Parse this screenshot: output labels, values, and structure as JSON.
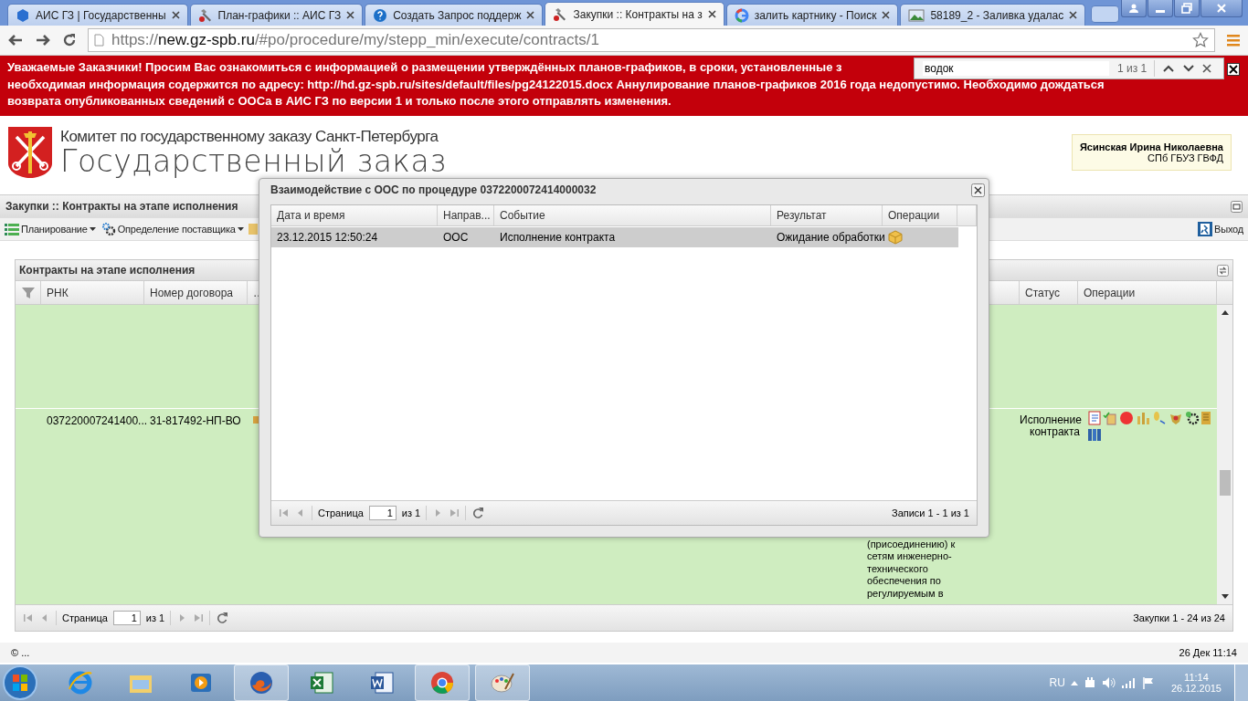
{
  "browser": {
    "tabs": [
      {
        "title": "АИС ГЗ | Государственны",
        "selected": false
      },
      {
        "title": "План-графики :: АИС ГЗ",
        "selected": false
      },
      {
        "title": "Создать Запрос поддерж",
        "selected": false
      },
      {
        "title": "Закупки :: Контракты на з",
        "selected": true
      },
      {
        "title": "залить картнику - Поиск",
        "selected": false
      },
      {
        "title": "58189_2 - Заливка удалас",
        "selected": false
      }
    ],
    "url_host": "new.gz-spb.ru",
    "url_scheme": "https://",
    "url_path": "/#po/procedure/my/stepp_min/execute/contracts/1",
    "find": {
      "value": "водок",
      "count": "1 из 1"
    }
  },
  "banner": [
    "Уважаемые Заказчики! Просим Вас ознакомиться с информацией о размещении утверждённых планов-графиков, в сроки, установленные з",
    "необходимая информация содержится по адресу: http://hd.gz-spb.ru/sites/default/files/pg24122015.docx Аннулирование планов-графиков 2016 года недопустимо. Необходимо дождаться",
    "возврата опубликованных сведений с ООСа в АИС ГЗ по версии 1 и только после этого отправлять изменения."
  ],
  "header": {
    "subtitle": "Комитет по государственному заказу Санкт-Петербурга",
    "title": "Государственный заказ",
    "user": "Ясинская Ирина Николаевна",
    "org": "СПб ГБУЗ ГВФД"
  },
  "panel": {
    "title": "Закупки :: Контракты на этапе исполнения",
    "menu": [
      "Планирование",
      "Определение поставщика"
    ],
    "exit": "Выход"
  },
  "grid": {
    "title": "Контракты на этапе исполнения",
    "columns": [
      "РНК",
      "Номер договора",
      "…",
      "Статус",
      "Операции"
    ],
    "row": {
      "rnk": "037220007241400...",
      "number": "31-817492-НП-ВО",
      "subject": "(присоединению) к сетям инженерно-технического обеспечения по регулируемым в",
      "status": "Исполнение контракта"
    },
    "pager": {
      "page_label": "Страница",
      "page": "1",
      "of": "из 1",
      "summary": "Закупки 1 - 24 из 24"
    }
  },
  "dialog": {
    "title": "Взаимодействие с ООС по процедуре 0372200072414000032",
    "columns": [
      "Дата и время",
      "Направ...",
      "Событие",
      "Результат",
      "Операции"
    ],
    "rows": [
      {
        "cells": [
          "23.12.2015 12:50:24",
          "ООС",
          "Исполнение контракта",
          "Ожидание обработки"
        ],
        "selected": true
      }
    ],
    "pager": {
      "page_label": "Страница",
      "page": "1",
      "of": "из 1",
      "summary": "Записи 1 - 1 из 1"
    }
  },
  "status_bar": {
    "left": "© ...",
    "right": "26 Дек 11:14"
  },
  "taskbar": {
    "apps": [
      {
        "kind": "ie",
        "open": false
      },
      {
        "kind": "explorer",
        "open": false
      },
      {
        "kind": "media",
        "open": false
      },
      {
        "kind": "firefox",
        "open": true
      },
      {
        "kind": "excel",
        "open": false
      },
      {
        "kind": "word",
        "open": false
      },
      {
        "kind": "chrome",
        "open": true
      },
      {
        "kind": "paint",
        "open": true
      }
    ],
    "language": "RU",
    "time": "11:14",
    "date": "26.12.2015"
  }
}
